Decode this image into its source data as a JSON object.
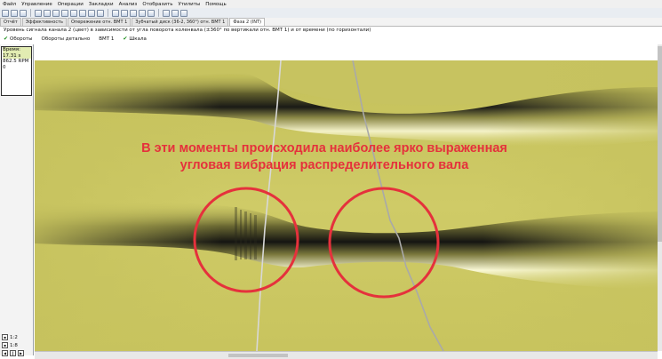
{
  "menu": [
    "Файл",
    "Управление",
    "Операции",
    "Закладки",
    "Анализ",
    "Отобразить",
    "Утилиты",
    "Помощь"
  ],
  "tabs": [
    {
      "label": "Отчёт",
      "active": false
    },
    {
      "label": "Эффективность",
      "active": false
    },
    {
      "label": "Опережение отн. ВМТ 1",
      "active": false
    },
    {
      "label": "Зубчатый диск (36-2, 360°) отн. ВМТ 1",
      "active": false
    },
    {
      "label": "Фаза 2 (INT)",
      "active": true
    }
  ],
  "description": "Уровень сигнала канала 2 (цвет) в зависимости от угла поворота коленвала (±360° по вертикали отн. ВМТ 1) и от времени (по горизонтали)",
  "options": {
    "revolutions": "Обороты",
    "revolutions_detail": "Обороты детально",
    "tdc": "ВМТ 1",
    "scale": "Шкала"
  },
  "readout": {
    "time_label": "Время:",
    "time_value": "17.31 s",
    "rpm": "862.5 RPM",
    "zero": "0"
  },
  "controls": {
    "zoom_a": "1:2",
    "zoom_b": "1:8"
  },
  "annotation": {
    "line1": "В эти моменты происходила наиболее ярко выраженная",
    "line2": "угловая вибрация распределительного вала"
  },
  "colors": {
    "annotation_red": "#e5313c",
    "plot_yellow": "#c9c561",
    "band_dark": "#181815",
    "band_light": "#f9f8d6"
  }
}
